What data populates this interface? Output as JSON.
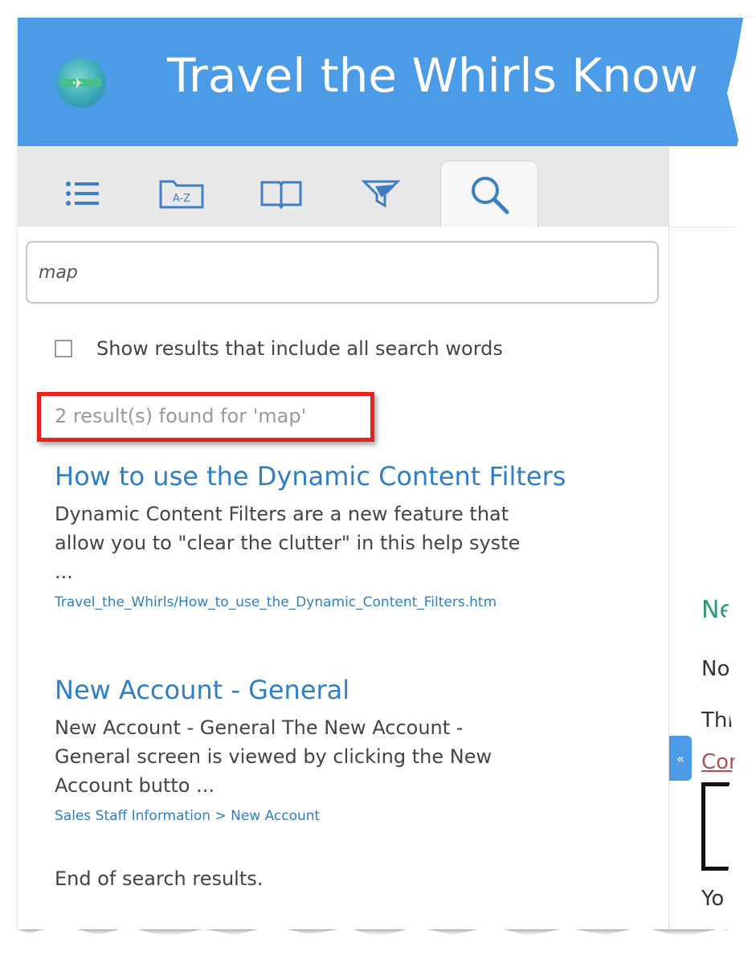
{
  "header": {
    "title": "Travel the Whirls Know"
  },
  "tabs": [
    {
      "id": "toc",
      "icon": "list-icon"
    },
    {
      "id": "index",
      "icon": "a-z-folder-icon",
      "label": "A-Z"
    },
    {
      "id": "glossary",
      "icon": "book-icon"
    },
    {
      "id": "filter",
      "icon": "filter-plane-icon"
    },
    {
      "id": "search",
      "icon": "search-icon",
      "active": true
    }
  ],
  "search": {
    "value": "map"
  },
  "options": {
    "all_words_label": "Show results that include all search words"
  },
  "results": {
    "count_text": "2 result(s) found for 'map'",
    "items": [
      {
        "title": "How to use the Dynamic Content Filters",
        "snippet": "Dynamic Content Filters are a new feature that\nallow you to \"clear the clutter\" in this help syste\n...",
        "path": "Travel_the_Whirls/How_to_use_the_Dynamic_Content_Filters.htm"
      },
      {
        "title": "New Account - General",
        "snippet": "New Account - General The New Account -\nGeneral screen is viewed by clicking the New\nAccount butto ...",
        "path": "Sales Staff Information > New Account"
      }
    ],
    "end_text": "End of search results."
  },
  "right_pane": {
    "heading": "New",
    "line1": "No",
    "line2": "This",
    "link": "Con",
    "line3": "Yo",
    "collapse_label": "«"
  },
  "colors": {
    "header_bg": "#4b9be6",
    "link_blue": "#2f7fc8",
    "highlight_red": "#e8221a"
  }
}
